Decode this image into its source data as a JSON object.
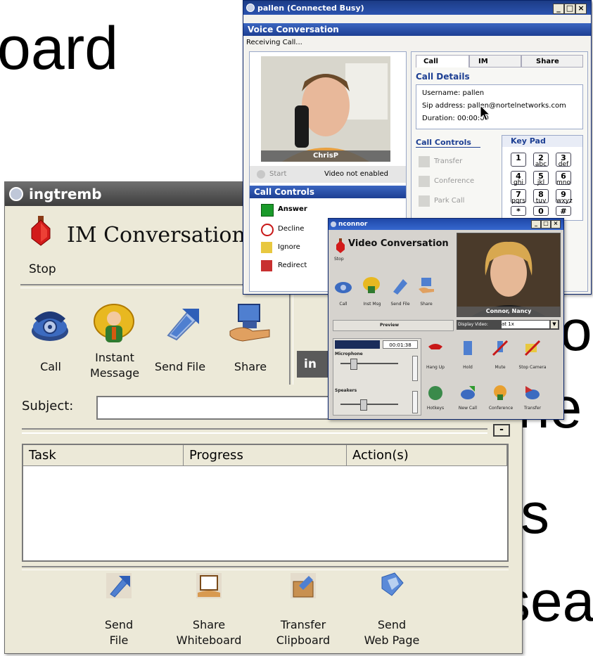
{
  "slide": {
    "fragment_top_left": "oard",
    "fragment_right_1": "o",
    "fragment_right_2": "ne",
    "fragment_right_3": "s",
    "fragment_right_4": "sea"
  },
  "im_window": {
    "title": "ingtremb",
    "heading": "IM Conversation",
    "stop_label": "Stop",
    "toolbar": {
      "call": "Call",
      "instant_message_1": "Instant",
      "instant_message_2": "Message",
      "send_file": "Send File",
      "share": "Share"
    },
    "subject_label": "Subject:",
    "subject_value": "",
    "tasks_table": {
      "columns": [
        "Task",
        "Progress",
        "Action(s)"
      ],
      "rows": []
    },
    "bottom_actions": [
      {
        "line1": "Send",
        "line2": "File",
        "icon": "send-file-icon"
      },
      {
        "line1": "Share",
        "line2": "Whiteboard",
        "icon": "share-whiteboard-icon"
      },
      {
        "line1": "Transfer",
        "line2": "Clipboard",
        "icon": "transfer-clipboard-icon"
      },
      {
        "line1": "Send",
        "line2": "Web Page",
        "icon": "send-web-page-icon"
      }
    ],
    "collapse_label": "-",
    "partial_tab_label": "in"
  },
  "voice_window": {
    "title": "pallen (Connected Busy)",
    "header": "Voice Conversation",
    "status": "Receiving Call...",
    "caller_name": "ChrisP",
    "start_label": "Start",
    "video_status": "Video not enabled",
    "tabs": [
      "Call",
      "IM",
      "Share"
    ],
    "call_details_title": "Call Details",
    "username_label": "Username:",
    "username_value": "pallen",
    "sip_label": "Sip address:",
    "sip_value": "pallen@nortelnetworks.com",
    "duration_label": "Duration:",
    "duration_value": "00:00:00",
    "call_controls_title": "Call Controls",
    "left_controls_title": "Call Controls",
    "right_controls": [
      "Transfer",
      "Conference",
      "Park Call"
    ],
    "left_controls": [
      "Answer",
      "Decline",
      "Ignore",
      "Redirect"
    ],
    "keypad_title": "Key Pad",
    "keypad": [
      {
        "num": "1",
        "letters": ""
      },
      {
        "num": "2",
        "letters": "abc"
      },
      {
        "num": "3",
        "letters": "def"
      },
      {
        "num": "4",
        "letters": "ghi"
      },
      {
        "num": "5",
        "letters": "jkl"
      },
      {
        "num": "6",
        "letters": "mno"
      },
      {
        "num": "7",
        "letters": "pqrs"
      },
      {
        "num": "8",
        "letters": "tuv"
      },
      {
        "num": "9",
        "letters": "wxyz"
      },
      {
        "num": "*",
        "letters": ""
      },
      {
        "num": "0",
        "letters": ""
      },
      {
        "num": "#",
        "letters": ""
      }
    ]
  },
  "video_window": {
    "title": "nconnor",
    "header": "Video Conversation",
    "stop_label": "Stop",
    "toolbar": [
      "Call",
      "Inst Msg",
      "Send File",
      "Share"
    ],
    "remote_name": "Connor, Nancy",
    "preview_label": "Preview",
    "display_video_label": "Display Video:",
    "display_video_value": "at 1x",
    "timer": "00:01:38",
    "microphone_label": "Microphone",
    "speakers_label": "Speakers",
    "controls_row1": [
      "Hang Up",
      "Hold",
      "Mute",
      "Stop Camera"
    ],
    "controls_row2": [
      "Hotkeys",
      "New Call",
      "Conference",
      "Transfer"
    ]
  },
  "colors": {
    "titlebar_blue": "#1c3c86",
    "panel_header_blue": "#2b53b0",
    "window_face": "#ece9d8",
    "im_titlebar": "#4a4a4a"
  }
}
